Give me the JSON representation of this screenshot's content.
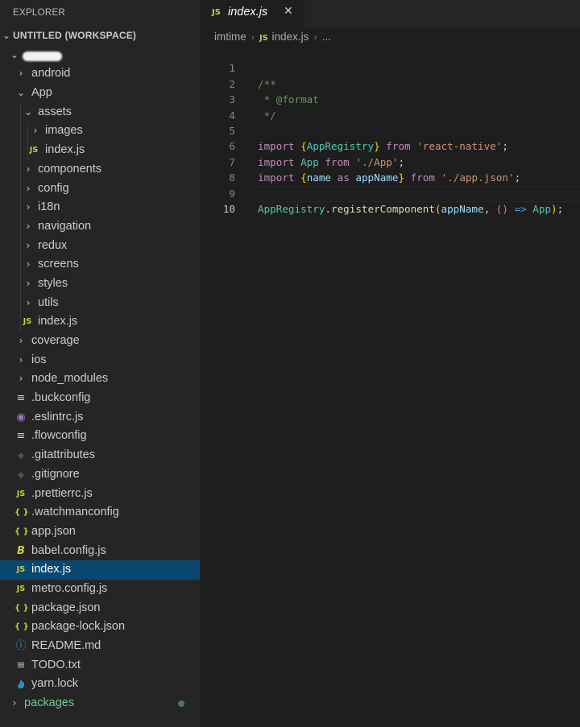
{
  "explorer": {
    "title": "EXPLORER",
    "workspace_label": "UNTITLED (WORKSPACE)",
    "items": [
      {
        "label": "android",
        "kind": "folder"
      },
      {
        "label": "App",
        "kind": "folder"
      },
      {
        "label": "assets",
        "kind": "folder"
      },
      {
        "label": "images",
        "kind": "folder"
      },
      {
        "label": "index.js",
        "kind": "js"
      },
      {
        "label": "components",
        "kind": "folder"
      },
      {
        "label": "config",
        "kind": "folder"
      },
      {
        "label": "i18n",
        "kind": "folder"
      },
      {
        "label": "navigation",
        "kind": "folder"
      },
      {
        "label": "redux",
        "kind": "folder"
      },
      {
        "label": "screens",
        "kind": "folder"
      },
      {
        "label": "styles",
        "kind": "folder"
      },
      {
        "label": "utils",
        "kind": "folder"
      },
      {
        "label": "index.js",
        "kind": "js"
      },
      {
        "label": "coverage",
        "kind": "folder"
      },
      {
        "label": "ios",
        "kind": "folder"
      },
      {
        "label": "node_modules",
        "kind": "folder"
      },
      {
        "label": ".buckconfig",
        "kind": "lines"
      },
      {
        "label": ".eslintrc.js",
        "kind": "eslint"
      },
      {
        "label": ".flowconfig",
        "kind": "lines"
      },
      {
        "label": ".gitattributes",
        "kind": "git"
      },
      {
        "label": ".gitignore",
        "kind": "git"
      },
      {
        "label": ".prettierrc.js",
        "kind": "js"
      },
      {
        "label": ".watchmanconfig",
        "kind": "json"
      },
      {
        "label": "app.json",
        "kind": "json"
      },
      {
        "label": "babel.config.js",
        "kind": "babel"
      },
      {
        "label": "index.js",
        "kind": "js"
      },
      {
        "label": "metro.config.js",
        "kind": "js"
      },
      {
        "label": "package.json",
        "kind": "json"
      },
      {
        "label": "package-lock.json",
        "kind": "json"
      },
      {
        "label": "README.md",
        "kind": "info"
      },
      {
        "label": "TODO.txt",
        "kind": "lines"
      },
      {
        "label": "yarn.lock",
        "kind": "yarn"
      },
      {
        "label": "packages",
        "kind": "folder"
      }
    ]
  },
  "icons": {
    "folder_collapsed": "chevron-right-icon",
    "folder_expanded": "chevron-down-icon",
    "js": "JS",
    "json": "{ }",
    "lines": "≡",
    "eslint": "◉",
    "git": "◆",
    "babel": "B",
    "info": "ⓘ",
    "yarn": "yarn-cat-icon"
  },
  "editor": {
    "tab_label": "index.js",
    "tab_icon": "JS",
    "breadcrumb": [
      "imtime",
      "index.js",
      "..."
    ],
    "code_lines": [
      "/**",
      " * @format",
      " */",
      "",
      "import {AppRegistry} from 'react-native';",
      "import App from './App';",
      "import {name as appName} from './app.json';",
      "",
      "AppRegistry.registerComponent(appName, () => App);",
      ""
    ],
    "line_numbers": [
      "1",
      "2",
      "3",
      "4",
      "5",
      "6",
      "7",
      "8",
      "9",
      "10"
    ]
  },
  "colors": {
    "background": "#1e1e1e",
    "sidebar": "#252526",
    "selection": "#094771",
    "js_icon": "#cbcb41",
    "json_icon": "#cbcb41",
    "keyword": "#c586c0",
    "string": "#ce9178",
    "comment": "#6a9955",
    "git_icon": "#41535b",
    "eslint_icon": "#a074c4",
    "packages_label": "#73c991"
  }
}
